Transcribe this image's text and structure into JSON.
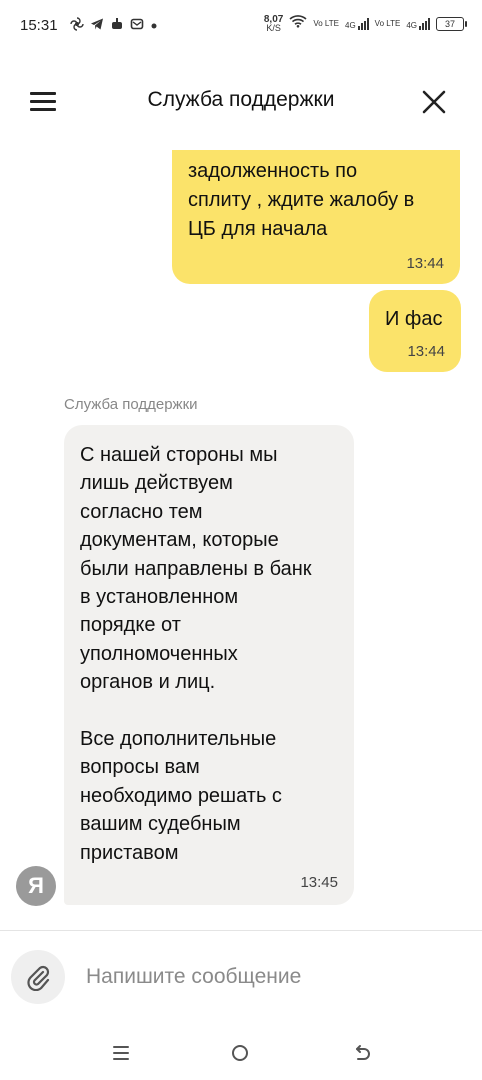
{
  "status_bar": {
    "time": "15:31",
    "left_icons": [
      "fan-icon",
      "telegram-icon",
      "game-icon",
      "mail-icon",
      "dot-icon"
    ],
    "net_speed_value": "8,07",
    "net_speed_unit": "K/S",
    "sim1_label": "Vo LTE",
    "sim1_net": "4G",
    "sim2_label": "Vo LTE",
    "sim2_net": "4G",
    "battery": "37"
  },
  "header": {
    "title": "Служба поддержки",
    "menu_icon": "hamburger-icon",
    "close_icon": "close-icon"
  },
  "chat": {
    "messages": [
      {
        "from": "me",
        "text": "погасить\nзадолженность по\nсплиту , ждите жалобу в\nЦБ для начала",
        "time": "13:44"
      },
      {
        "from": "me",
        "text": "И фас",
        "time": "13:44"
      },
      {
        "from": "support",
        "sender": "Служба поддержки",
        "text": "С нашей стороны мы\nлишь действуем\nсогласно тем\nдокументам, которые\nбыли направлены в банк\nв установленном\nпорядке от\nуполномоченных\nорганов и лиц.\n\nВсе дополнительные\nвопросы вам\nнеобходимо решать с\nвашим судебным\nприставом",
        "time": "13:45",
        "avatar_letter": "Я"
      }
    ]
  },
  "composer": {
    "placeholder": "Напишите сообщение",
    "value": "",
    "attach_icon": "paperclip-icon"
  },
  "nav_bar": {
    "buttons": [
      "recent-apps-icon",
      "home-icon",
      "back-icon"
    ]
  },
  "colors": {
    "outgoing_bubble": "#fbe36a",
    "incoming_bubble": "#f2f1ef",
    "avatar": "#9a9a9a"
  }
}
